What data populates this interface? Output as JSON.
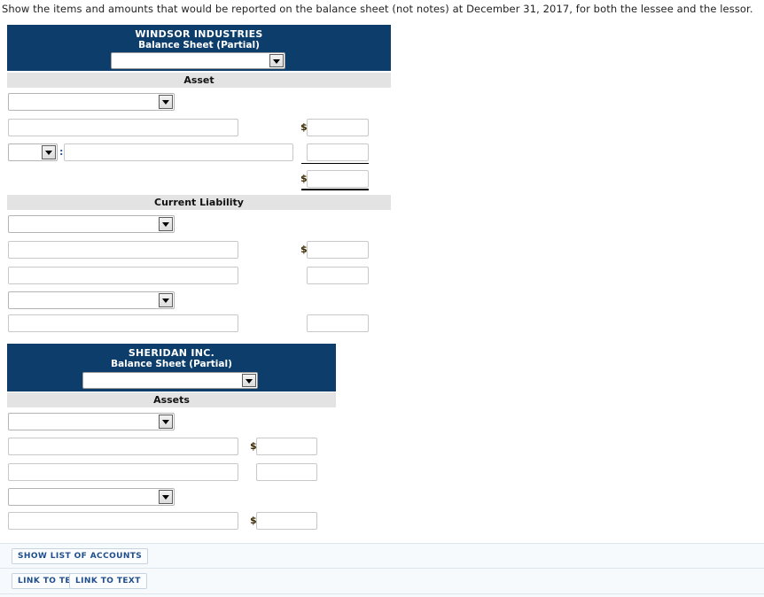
{
  "prompt": "Show the items and amounts that would be reported on the balance sheet (not notes) at December 31, 2017, for both the lessee and the lessor.",
  "colors": {
    "header_navy": "#0c3d6b",
    "band_gray": "#e3e3e3",
    "footer_bg": "#f6fafc",
    "button_text": "#1f4e8c",
    "dollar": "#3a2a00",
    "colon": "#2d5b8e"
  },
  "windsor": {
    "company": "WINDSOR INDUSTRIES",
    "subtitle": "Balance Sheet (Partial)",
    "date_select": {
      "value": "",
      "placeholder": ""
    },
    "sections": [
      {
        "band_label": "Asset",
        "rows": [
          {
            "type": "select",
            "value": ""
          },
          {
            "type": "text_amount",
            "text": "",
            "amount": "",
            "dollar": "$"
          },
          {
            "type": "select_colon_text_amount",
            "select_value": "",
            "colon": ":",
            "text": "",
            "amount": "",
            "dollar": "",
            "underline": "thin"
          },
          {
            "type": "amount_only",
            "amount": "",
            "dollar": "$",
            "underline": "thick"
          }
        ]
      },
      {
        "band_label": "Current Liability",
        "rows": [
          {
            "type": "select",
            "value": ""
          },
          {
            "type": "text_amount",
            "text": "",
            "amount": "",
            "dollar": "$"
          },
          {
            "type": "text_amount",
            "text": "",
            "amount": "",
            "dollar": ""
          },
          {
            "type": "select",
            "value": ""
          },
          {
            "type": "text_amount",
            "text": "",
            "amount": "",
            "dollar": ""
          }
        ]
      }
    ]
  },
  "sheridan": {
    "company": "SHERIDAN INC.",
    "subtitle": "Balance Sheet (Partial)",
    "date_select": {
      "value": "",
      "placeholder": ""
    },
    "sections": [
      {
        "band_label": "Assets",
        "rows": [
          {
            "type": "select",
            "value": ""
          },
          {
            "type": "text_amount",
            "text": "",
            "amount": "",
            "dollar": "$"
          },
          {
            "type": "text_amount",
            "text": "",
            "amount": "",
            "dollar": ""
          },
          {
            "type": "select",
            "value": ""
          },
          {
            "type": "text_amount",
            "text": "",
            "amount": "",
            "dollar": "$"
          }
        ]
      }
    ]
  },
  "footer": {
    "show_list_label": "SHOW LIST OF ACCOUNTS",
    "link_to_text_1": "LINK TO TEXT",
    "link_to_text_2": "LINK TO TEXT"
  }
}
